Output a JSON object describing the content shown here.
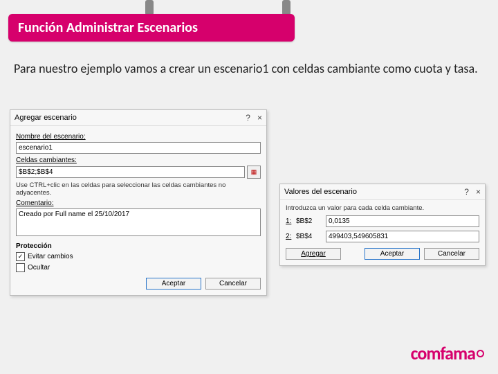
{
  "header": {
    "title": "Función Administrar Escenarios"
  },
  "intro": "Para nuestro ejemplo vamos a crear un escenario1 con celdas cambiante como cuota y tasa.",
  "dialog_add": {
    "title": "Agregar escenario",
    "name_label": "Nombre del escenario:",
    "name_value": "escenario1",
    "cells_label": "Celdas cambiantes:",
    "cells_value": "$B$2;$B$4",
    "hint": "Use CTRL+clic en las celdas para seleccionar las celdas cambiantes no adyacentes.",
    "comment_label": "Comentario:",
    "comment_value": "Creado por Full name el 25/10/2017",
    "protection_label": "Protección",
    "chk1_label": "Evitar cambios",
    "chk2_label": "Ocultar",
    "ok": "Aceptar",
    "cancel": "Cancelar"
  },
  "dialog_values": {
    "title": "Valores del escenario",
    "intro": "Introduzca un valor para cada celda cambiante.",
    "row1_num": "1:",
    "row1_cell": "$B$2",
    "row1_val": "0,0135",
    "row2_num": "2:",
    "row2_cell": "$B$4",
    "row2_val": "499403,549605831",
    "add": "Agregar",
    "ok": "Aceptar",
    "cancel": "Cancelar"
  },
  "brand": "comfama"
}
